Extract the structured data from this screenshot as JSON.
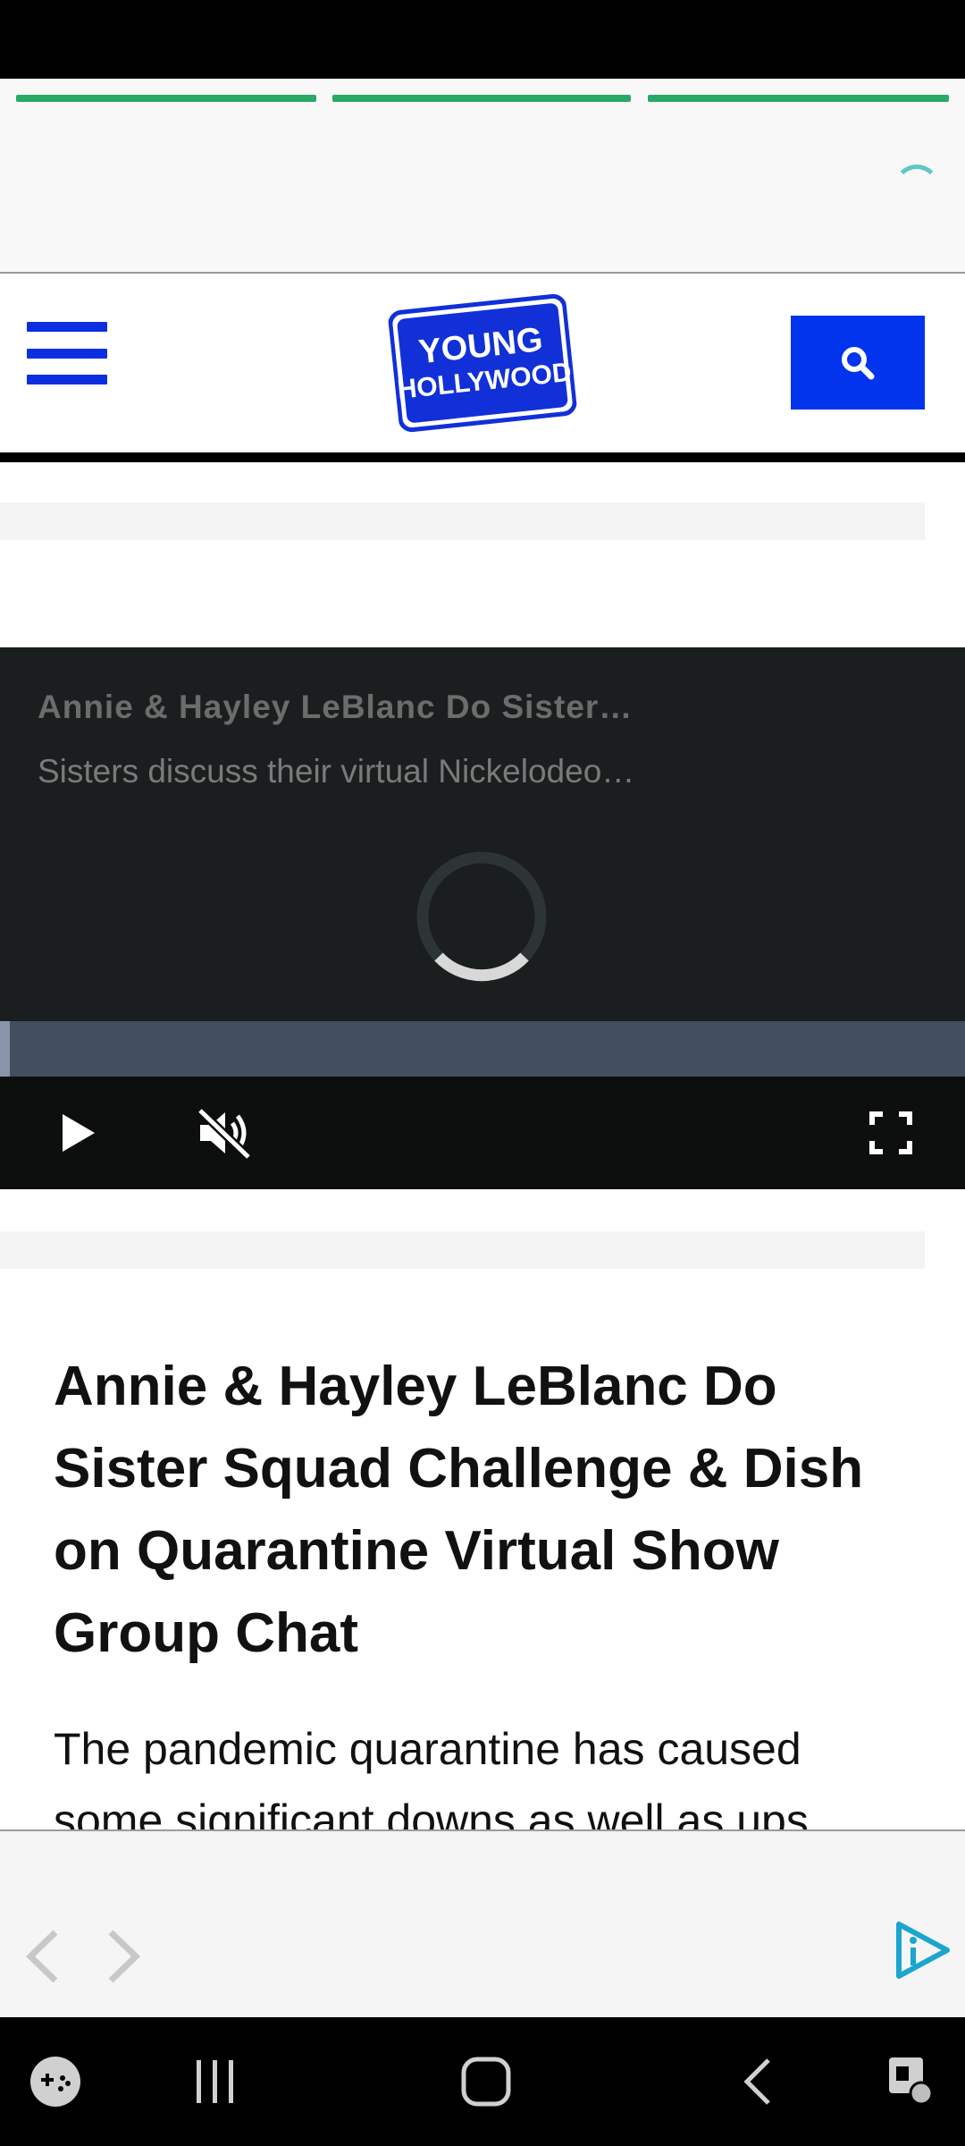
{
  "colors": {
    "story_progress": "#2aa869",
    "brand_blue": "#0234ee",
    "video_bg": "#1a1e1e",
    "ad_icon": "#1ba5cf"
  },
  "header": {
    "logo_text_line1": "YOUNG",
    "logo_text_line2": "HOLLYWOOD",
    "menu_icon": "hamburger-menu-icon",
    "search_icon": "search-icon"
  },
  "video": {
    "title": "Annie & Hayley LeBlanc Do Sister…",
    "description": "Sisters discuss their virtual Nickelodeo…",
    "buffered_fraction": 0.01,
    "controls": [
      "play-icon",
      "muted-speaker-icon",
      "fullscreen-icon"
    ]
  },
  "article": {
    "title": "Annie & Hayley LeBlanc Do Sister Squad Challenge & Dish on Quarantine Virtual Show Group Chat",
    "body": "The pandemic quarantine has caused some significant downs as well as ups"
  },
  "bottom_nav": {
    "back_icon": "chevron-left-icon",
    "forward_icon": "chevron-right-icon",
    "ad_icon": "ad-choices-icon"
  },
  "system_nav": [
    "game-launcher-icon",
    "recent-apps-icon",
    "home-icon",
    "back-icon",
    "accessibility-icon"
  ]
}
